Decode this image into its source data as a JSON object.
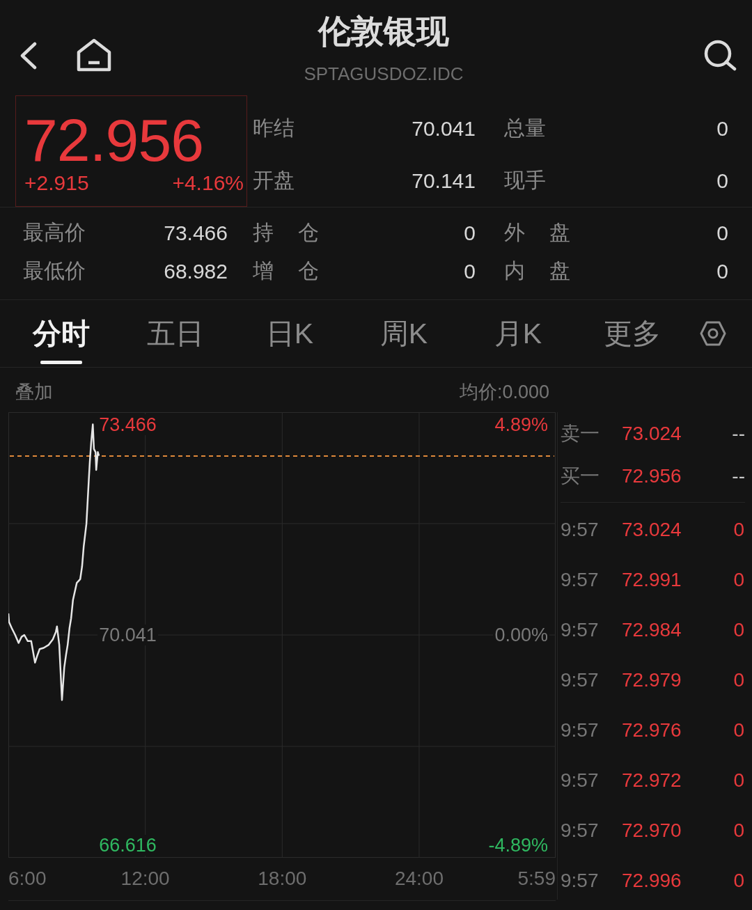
{
  "header": {
    "title": "伦敦银现",
    "subtitle": "SPTAGUSDOZ.IDC"
  },
  "quote": {
    "price": "72.956",
    "change": "+2.915",
    "change_percent": "+4.16%",
    "rising": true
  },
  "summary_stats": [
    {
      "label": "昨结",
      "value": "70.041"
    },
    {
      "label": "总量",
      "value": "0"
    },
    {
      "label": "开盘",
      "value": "70.141"
    },
    {
      "label": "现手",
      "value": "0"
    }
  ],
  "detail_stats": [
    {
      "label": "最高价",
      "value": "73.466"
    },
    {
      "label": "持 仓",
      "value": "0"
    },
    {
      "label": "外 盘",
      "value": "0"
    },
    {
      "label": "最低价",
      "value": "68.982"
    },
    {
      "label": "增 仓",
      "value": "0"
    },
    {
      "label": "内 盘",
      "value": "0"
    }
  ],
  "tabs": [
    {
      "label": "分时",
      "selected": true
    },
    {
      "label": "五日",
      "selected": false
    },
    {
      "label": "日K",
      "selected": false
    },
    {
      "label": "周K",
      "selected": false
    },
    {
      "label": "月K",
      "selected": false
    },
    {
      "label": "更多",
      "selected": false
    }
  ],
  "chart": {
    "overlay_label": "叠加",
    "average_price": "均价:0.000",
    "percent_labels": [
      "4.89%",
      "0.00%",
      "-4.89%"
    ],
    "end_time_label": "5:59",
    "chart_data": {
      "type": "line",
      "x": [
        6,
        6.03,
        6.15,
        6.3,
        6.45,
        6.58,
        6.7,
        6.85,
        7,
        7.17,
        7.28,
        7.37,
        7.55,
        7.77,
        7.95,
        8.08,
        8.13,
        8.23,
        8.28,
        8.35,
        8.45,
        8.53,
        8.6,
        8.68,
        8.75,
        8.83,
        9,
        9.15,
        9.23,
        9.3,
        9.42,
        9.52,
        9.57,
        9.63,
        9.7,
        9.75,
        9.82,
        9.85,
        9.92,
        9.97
      ],
      "series": [
        {
          "color": "#e6e6e6",
          "values": [
            70.39,
            70.25,
            70.15,
            70.04,
            69.91,
            70.01,
            70.04,
            69.94,
            69.94,
            69.59,
            69.72,
            69.81,
            69.83,
            69.88,
            69.97,
            70.09,
            70.18,
            69.88,
            69.51,
            68.98,
            69.51,
            69.72,
            69.88,
            70.15,
            70.31,
            70.61,
            70.89,
            70.95,
            71.16,
            71.48,
            71.85,
            72.54,
            72.86,
            73.18,
            73.47,
            73.07,
            73.02,
            72.73,
            73.02,
            72.96
          ]
        }
      ],
      "xlim": [
        6,
        29.98
      ],
      "ylim": [
        66.41,
        73.67
      ],
      "grid": true,
      "xticks": [
        {
          "value": 6,
          "label": "6:00"
        },
        {
          "value": 12,
          "label": "12:00"
        },
        {
          "value": 18,
          "label": "18:00"
        },
        {
          "value": 24,
          "label": "24:00"
        }
      ],
      "yticks": [
        {
          "value": 73.466,
          "label": "73.466"
        },
        {
          "value": 70.041,
          "label": "70.041"
        },
        {
          "value": 66.616,
          "label": "66.616"
        }
      ],
      "ref_lines": [
        {
          "axis": "y",
          "value": 72.956
        }
      ]
    }
  },
  "order_book": {
    "quotes": [
      {
        "label": "卖一",
        "price": "73.024",
        "volume": "--",
        "rising": true
      },
      {
        "label": "买一",
        "price": "72.956",
        "volume": "--",
        "rising": true
      }
    ],
    "trades": [
      {
        "time": "9:57",
        "price": "73.024",
        "volume": "0",
        "rising": true
      },
      {
        "time": "9:57",
        "price": "72.991",
        "volume": "0",
        "rising": true
      },
      {
        "time": "9:57",
        "price": "72.984",
        "volume": "0",
        "rising": true
      },
      {
        "time": "9:57",
        "price": "72.979",
        "volume": "0",
        "rising": true
      },
      {
        "time": "9:57",
        "price": "72.976",
        "volume": "0",
        "rising": true
      },
      {
        "time": "9:57",
        "price": "72.972",
        "volume": "0",
        "rising": true
      },
      {
        "time": "9:57",
        "price": "72.970",
        "volume": "0",
        "rising": true
      },
      {
        "time": "9:57",
        "price": "72.996",
        "volume": "0",
        "rising": true
      }
    ]
  }
}
